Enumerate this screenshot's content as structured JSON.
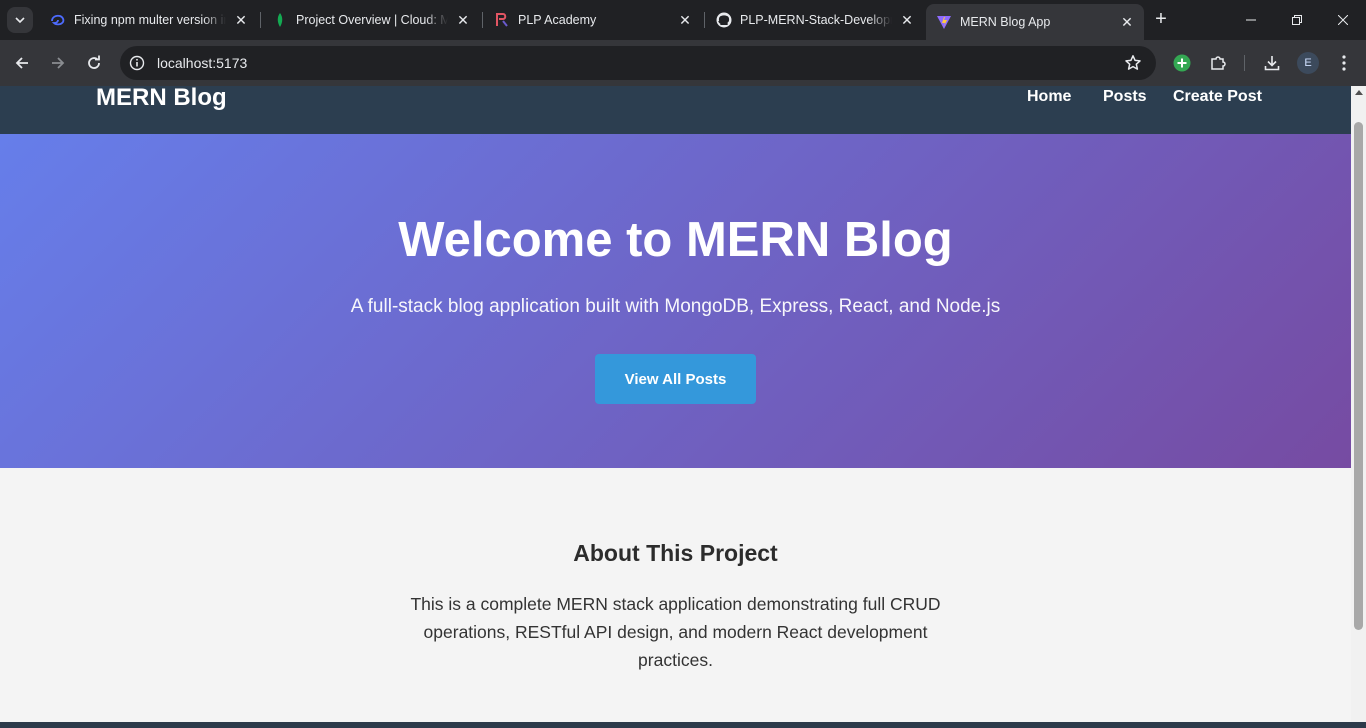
{
  "browser": {
    "tabs": [
      {
        "title": "Fixing npm multer version in",
        "icon": "deepseek-whale-icon"
      },
      {
        "title": "Project Overview | Cloud: Mo",
        "icon": "mongodb-leaf-icon"
      },
      {
        "title": "PLP Academy",
        "icon": "plp-logo-icon"
      },
      {
        "title": "PLP-MERN-Stack-Developme",
        "icon": "github-icon"
      },
      {
        "title": "MERN Blog App",
        "icon": "vite-icon",
        "active": true
      }
    ],
    "url": "localhost:5173",
    "profile_initial": "E",
    "accent_color": "#34a853"
  },
  "page": {
    "navbar": {
      "brand": "MERN Blog",
      "links": [
        "Home",
        "Posts",
        "Create Post"
      ],
      "color": "#2c3e50"
    },
    "hero": {
      "title": "Welcome to MERN Blog",
      "subtitle": "A full-stack blog application built with MongoDB, Express, React, and Node.js",
      "button": "View All Posts",
      "gradient_start": "#667eea",
      "gradient_end": "#764ba2",
      "button_color": "#3498db"
    },
    "about": {
      "heading": "About This Project",
      "body": "This is a complete MERN stack application demonstrating full CRUD operations, RESTful API design, and modern React development practices."
    }
  }
}
